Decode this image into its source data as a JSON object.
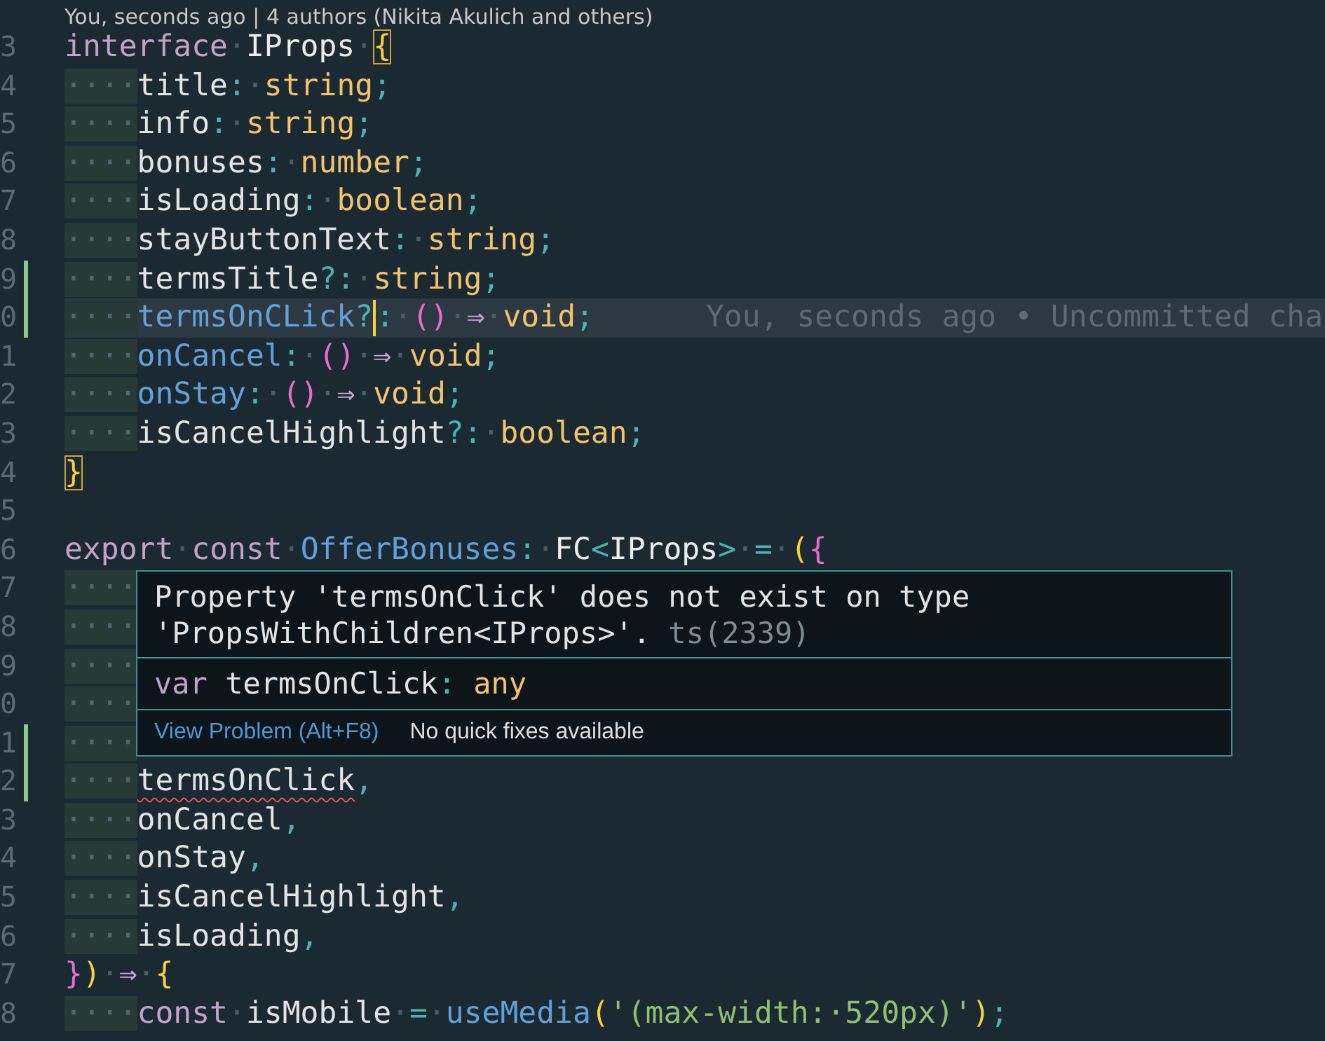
{
  "codelens": "You, seconds ago | 4 authors (Nikita Akulich and others)",
  "lines": [
    {
      "number": "3",
      "modified": false,
      "current": false,
      "tokens": [
        {
          "kind": "kw",
          "text": "interface"
        },
        {
          "kind": "ws",
          "text": "·"
        },
        {
          "kind": "type",
          "text": "IProps"
        },
        {
          "kind": "ws",
          "text": "·"
        },
        {
          "kind": "match",
          "text": "{"
        }
      ]
    },
    {
      "number": "4",
      "modified": false,
      "current": false,
      "tokens": [
        {
          "kind": "indent",
          "text": "····"
        },
        {
          "kind": "prop",
          "text": "title"
        },
        {
          "kind": "punct",
          "text": ":"
        },
        {
          "kind": "ws",
          "text": "·"
        },
        {
          "kind": "prim",
          "text": "string"
        },
        {
          "kind": "punct",
          "text": ";"
        }
      ]
    },
    {
      "number": "5",
      "modified": false,
      "current": false,
      "tokens": [
        {
          "kind": "indent",
          "text": "····"
        },
        {
          "kind": "prop",
          "text": "info"
        },
        {
          "kind": "punct",
          "text": ":"
        },
        {
          "kind": "ws",
          "text": "·"
        },
        {
          "kind": "prim",
          "text": "string"
        },
        {
          "kind": "punct",
          "text": ";"
        }
      ]
    },
    {
      "number": "6",
      "modified": false,
      "current": false,
      "tokens": [
        {
          "kind": "indent",
          "text": "····"
        },
        {
          "kind": "prop",
          "text": "bonuses"
        },
        {
          "kind": "punct",
          "text": ":"
        },
        {
          "kind": "ws",
          "text": "·"
        },
        {
          "kind": "prim",
          "text": "number"
        },
        {
          "kind": "punct",
          "text": ";"
        }
      ]
    },
    {
      "number": "7",
      "modified": false,
      "current": false,
      "tokens": [
        {
          "kind": "indent",
          "text": "····"
        },
        {
          "kind": "prop",
          "text": "isLoading"
        },
        {
          "kind": "punct",
          "text": ":"
        },
        {
          "kind": "ws",
          "text": "·"
        },
        {
          "kind": "prim",
          "text": "boolean"
        },
        {
          "kind": "punct",
          "text": ";"
        }
      ]
    },
    {
      "number": "8",
      "modified": false,
      "current": false,
      "tokens": [
        {
          "kind": "indent",
          "text": "····"
        },
        {
          "kind": "prop",
          "text": "stayButtonText"
        },
        {
          "kind": "punct",
          "text": ":"
        },
        {
          "kind": "ws",
          "text": "·"
        },
        {
          "kind": "prim",
          "text": "string"
        },
        {
          "kind": "punct",
          "text": ";"
        }
      ]
    },
    {
      "number": "9",
      "modified": true,
      "current": false,
      "tokens": [
        {
          "kind": "indent",
          "text": "····"
        },
        {
          "kind": "prop",
          "text": "termsTitle"
        },
        {
          "kind": "punct",
          "text": "?:"
        },
        {
          "kind": "ws",
          "text": "·"
        },
        {
          "kind": "prim",
          "text": "string"
        },
        {
          "kind": "punct",
          "text": ";"
        }
      ]
    },
    {
      "number": "0",
      "modified": true,
      "current": true,
      "blame": "You, seconds ago • Uncommitted cha",
      "tokens": [
        {
          "kind": "indent",
          "text": "····"
        },
        {
          "kind": "fn",
          "text": "termsOnCLick"
        },
        {
          "kind": "punct",
          "text": "?",
          "cursor": true
        },
        {
          "kind": "punct",
          "text": ":"
        },
        {
          "kind": "ws",
          "text": "·"
        },
        {
          "kind": "br2",
          "text": "()"
        },
        {
          "kind": "ws",
          "text": "·"
        },
        {
          "kind": "op",
          "text": "⇒"
        },
        {
          "kind": "ws",
          "text": "·"
        },
        {
          "kind": "prim",
          "text": "void"
        },
        {
          "kind": "punct",
          "text": ";"
        }
      ]
    },
    {
      "number": "1",
      "modified": false,
      "current": false,
      "tokens": [
        {
          "kind": "indent",
          "text": "····"
        },
        {
          "kind": "fn",
          "text": "onCancel"
        },
        {
          "kind": "punct",
          "text": ":"
        },
        {
          "kind": "ws",
          "text": "·"
        },
        {
          "kind": "br2",
          "text": "()"
        },
        {
          "kind": "ws",
          "text": "·"
        },
        {
          "kind": "op",
          "text": "⇒"
        },
        {
          "kind": "ws",
          "text": "·"
        },
        {
          "kind": "prim",
          "text": "void"
        },
        {
          "kind": "punct",
          "text": ";"
        }
      ]
    },
    {
      "number": "2",
      "modified": false,
      "current": false,
      "tokens": [
        {
          "kind": "indent",
          "text": "····"
        },
        {
          "kind": "fn",
          "text": "onStay"
        },
        {
          "kind": "punct",
          "text": ":"
        },
        {
          "kind": "ws",
          "text": "·"
        },
        {
          "kind": "br2",
          "text": "()"
        },
        {
          "kind": "ws",
          "text": "·"
        },
        {
          "kind": "op",
          "text": "⇒"
        },
        {
          "kind": "ws",
          "text": "·"
        },
        {
          "kind": "prim",
          "text": "void"
        },
        {
          "kind": "punct",
          "text": ";"
        }
      ]
    },
    {
      "number": "3",
      "modified": false,
      "current": false,
      "tokens": [
        {
          "kind": "indent",
          "text": "····"
        },
        {
          "kind": "prop",
          "text": "isCancelHighlight"
        },
        {
          "kind": "punct",
          "text": "?:"
        },
        {
          "kind": "ws",
          "text": "·"
        },
        {
          "kind": "prim",
          "text": "boolean"
        },
        {
          "kind": "punct",
          "text": ";"
        }
      ]
    },
    {
      "number": "4",
      "modified": false,
      "current": false,
      "tokens": [
        {
          "kind": "match",
          "text": "}"
        }
      ]
    },
    {
      "number": "5",
      "modified": false,
      "current": false
    },
    {
      "number": "6",
      "modified": false,
      "current": false,
      "tokens": [
        {
          "kind": "kw",
          "text": "export"
        },
        {
          "kind": "ws",
          "text": "·"
        },
        {
          "kind": "kw",
          "text": "const"
        },
        {
          "kind": "ws",
          "text": "·"
        },
        {
          "kind": "fn",
          "text": "OfferBonuses"
        },
        {
          "kind": "punct",
          "text": ":"
        },
        {
          "kind": "ws",
          "text": "·"
        },
        {
          "kind": "type",
          "text": "FC"
        },
        {
          "kind": "punct",
          "text": "<"
        },
        {
          "kind": "type",
          "text": "IProps"
        },
        {
          "kind": "punct",
          "text": ">"
        },
        {
          "kind": "ws",
          "text": "·"
        },
        {
          "kind": "punct",
          "text": "="
        },
        {
          "kind": "ws",
          "text": "·"
        },
        {
          "kind": "br1",
          "text": "("
        },
        {
          "kind": "br2",
          "text": "{"
        }
      ]
    },
    {
      "number": "7",
      "modified": false,
      "current": false,
      "tokens": [
        {
          "kind": "indent",
          "text": "····"
        }
      ]
    },
    {
      "number": "8",
      "modified": false,
      "current": false,
      "tokens": [
        {
          "kind": "indent",
          "text": "····"
        }
      ]
    },
    {
      "number": "9",
      "modified": false,
      "current": false,
      "tokens": [
        {
          "kind": "indent",
          "text": "····"
        }
      ]
    },
    {
      "number": "0",
      "modified": false,
      "current": false,
      "tokens": [
        {
          "kind": "indent",
          "text": "····"
        }
      ]
    },
    {
      "number": "1",
      "modified": true,
      "current": false,
      "tokens": [
        {
          "kind": "indent",
          "text": "····"
        }
      ]
    },
    {
      "number": "2",
      "modified": true,
      "current": false,
      "tokens": [
        {
          "kind": "indent",
          "text": "····"
        },
        {
          "kind": "error",
          "text": "termsOnClick"
        },
        {
          "kind": "punct",
          "text": ","
        }
      ]
    },
    {
      "number": "3",
      "modified": false,
      "current": false,
      "tokens": [
        {
          "kind": "indent",
          "text": "····"
        },
        {
          "kind": "prop",
          "text": "onCancel"
        },
        {
          "kind": "punct",
          "text": ","
        }
      ]
    },
    {
      "number": "4",
      "modified": false,
      "current": false,
      "tokens": [
        {
          "kind": "indent",
          "text": "····"
        },
        {
          "kind": "prop",
          "text": "onStay"
        },
        {
          "kind": "punct",
          "text": ","
        }
      ]
    },
    {
      "number": "5",
      "modified": false,
      "current": false,
      "tokens": [
        {
          "kind": "indent",
          "text": "····"
        },
        {
          "kind": "prop",
          "text": "isCancelHighlight"
        },
        {
          "kind": "punct",
          "text": ","
        }
      ]
    },
    {
      "number": "6",
      "modified": false,
      "current": false,
      "tokens": [
        {
          "kind": "indent",
          "text": "····"
        },
        {
          "kind": "prop",
          "text": "isLoading"
        },
        {
          "kind": "punct",
          "text": ","
        }
      ]
    },
    {
      "number": "7",
      "modified": false,
      "current": false,
      "tokens": [
        {
          "kind": "br2",
          "text": "}"
        },
        {
          "kind": "br1",
          "text": ")"
        },
        {
          "kind": "ws",
          "text": "·"
        },
        {
          "kind": "op",
          "text": "⇒"
        },
        {
          "kind": "ws",
          "text": "·"
        },
        {
          "kind": "br1",
          "text": "{"
        }
      ]
    },
    {
      "number": "8",
      "modified": false,
      "current": false,
      "tokens": [
        {
          "kind": "indent",
          "text": "····"
        },
        {
          "kind": "kw",
          "text": "const"
        },
        {
          "kind": "ws",
          "text": "·"
        },
        {
          "kind": "prop",
          "text": "isMobile"
        },
        {
          "kind": "ws",
          "text": "·"
        },
        {
          "kind": "punct",
          "text": "="
        },
        {
          "kind": "ws",
          "text": "·"
        },
        {
          "kind": "fn",
          "text": "useMedia"
        },
        {
          "kind": "br1",
          "text": "("
        },
        {
          "kind": "str",
          "text": "'(max-width:·520px)'"
        },
        {
          "kind": "br1",
          "text": ")"
        },
        {
          "kind": "punct",
          "text": ";"
        }
      ]
    }
  ],
  "hover": {
    "message": "Property 'termsOnClick' does not exist on type 'PropsWithChildren<IProps>'.",
    "code": "ts(2339)",
    "signature": [
      {
        "kind": "kw",
        "text": "var"
      },
      {
        "kind": "plain",
        "text": " termsOnClick"
      },
      {
        "kind": "punct",
        "text": ":"
      },
      {
        "kind": "prim",
        "text": " any"
      }
    ],
    "link": "View Problem (Alt+F8)",
    "status": "No quick fixes available"
  }
}
